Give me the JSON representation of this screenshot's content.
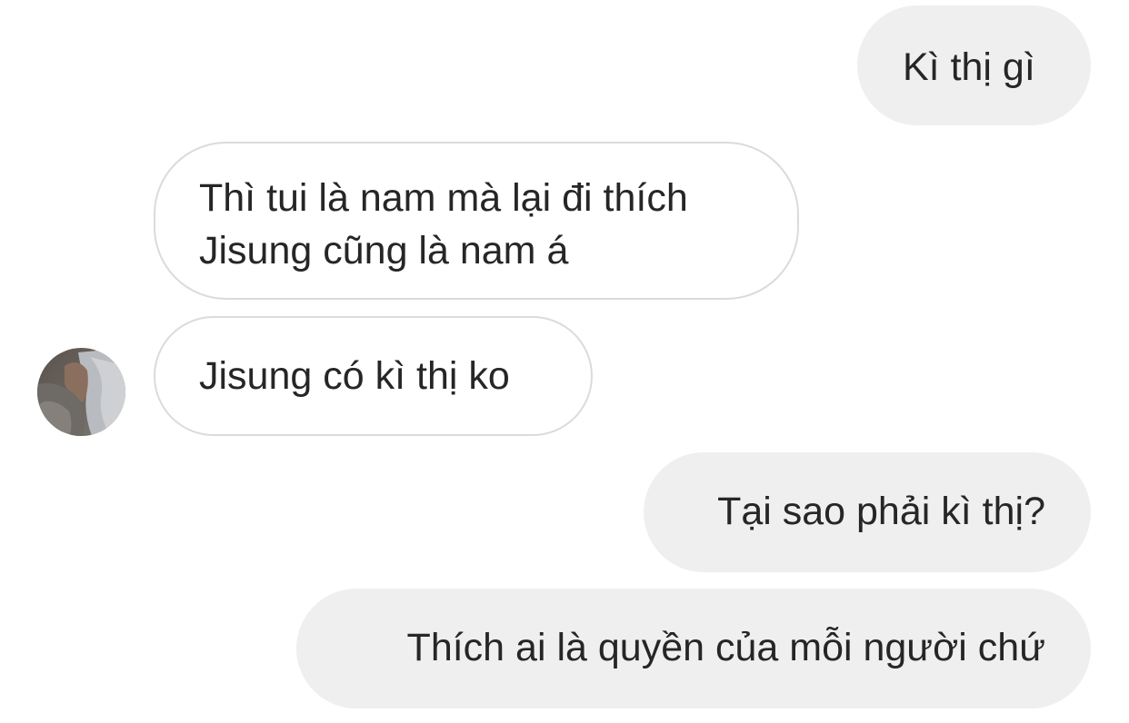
{
  "conversation": {
    "messages": [
      {
        "sender": "me",
        "text": "Kì thị gì"
      },
      {
        "sender": "other",
        "lines": [
          "Thì tui là nam mà lại đi thích",
          "Jisung cũng là nam á"
        ]
      },
      {
        "sender": "other",
        "text": "Jisung có kì thị ko"
      },
      {
        "sender": "me",
        "text": "Tại sao phải kì thị?"
      },
      {
        "sender": "me",
        "text": "Thích ai là quyền của mỗi người chứ"
      }
    ],
    "avatar_icon": "user-avatar-photo"
  },
  "colors": {
    "sent_bubble": "#efefef",
    "received_border": "#dbdbdb",
    "text": "#262626",
    "background": "#ffffff"
  }
}
